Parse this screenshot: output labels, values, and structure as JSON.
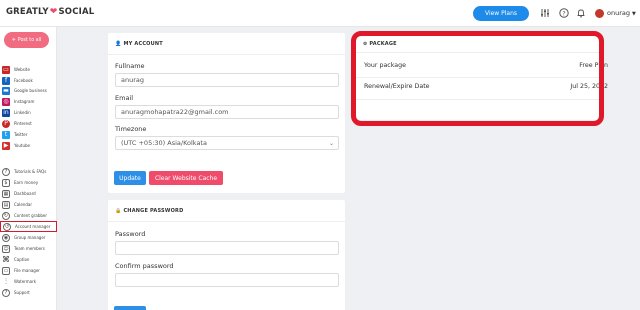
{
  "header": {
    "logo_left": "GREATLY",
    "logo_right": "SOCIAL",
    "view_plans": "View Plans",
    "icons": [
      "sliders-icon",
      "help-icon",
      "bell-icon"
    ],
    "username": "onurag"
  },
  "sidebar": {
    "post_button": "Post to all",
    "items": [
      {
        "label": "Website",
        "icon": "monitor-icon",
        "color": "#c62828"
      },
      {
        "label": "Facebook",
        "icon": "facebook-icon",
        "color": "#1565c0"
      },
      {
        "label": "Google business",
        "icon": "google-business-icon",
        "color": "#1976d2"
      },
      {
        "label": "Instagram",
        "icon": "instagram-icon",
        "color": "#c2185b"
      },
      {
        "label": "Linkedin",
        "icon": "linkedin-icon",
        "color": "#0d47a1"
      },
      {
        "label": "Pinterest",
        "icon": "pinterest-icon",
        "color": "#c62828"
      },
      {
        "label": "Twitter",
        "icon": "twitter-icon",
        "color": "#1da1f2"
      },
      {
        "label": "Youtube",
        "icon": "youtube-icon",
        "color": "#d32f2f"
      },
      {
        "label": "Tutorials & FAQs",
        "icon": "question-icon"
      },
      {
        "label": "Earn money",
        "icon": "money-icon"
      },
      {
        "label": "Dashboard",
        "icon": "dashboard-icon"
      },
      {
        "label": "Calendar",
        "icon": "calendar-icon"
      },
      {
        "label": "Content grabber",
        "icon": "grabber-icon"
      },
      {
        "label": "Account manager",
        "icon": "account-icon"
      },
      {
        "label": "Group manager",
        "icon": "group-icon"
      },
      {
        "label": "Team members",
        "icon": "team-icon"
      },
      {
        "label": "Caption",
        "icon": "caption-icon"
      },
      {
        "label": "File manager",
        "icon": "folder-icon"
      },
      {
        "label": "Watermark",
        "icon": "watermark-icon"
      },
      {
        "label": "Support",
        "icon": "support-icon"
      }
    ]
  },
  "account": {
    "title": "MY ACCOUNT",
    "fullname_label": "Fullname",
    "fullname_value": "anurag",
    "email_label": "Email",
    "email_value": "anuragmohapatra22@gmail.com",
    "timezone_label": "Timezone",
    "timezone_value": "(UTC +05:30) Asia/Kolkata",
    "update_button": "Update",
    "clear_cache_button": "Clear Website Cache"
  },
  "password": {
    "title": "CHANGE PASSWORD",
    "password_label": "Password",
    "confirm_label": "Confirm password"
  },
  "package": {
    "title": "PACKAGE",
    "your_package_label": "Your package",
    "your_package_value": "Free Plan",
    "renewal_label": "Renewal/Expire Date",
    "renewal_value": "Jul 25, 2022"
  },
  "colors": {
    "primary": "#1e8bea",
    "pink": "#ef4b6b",
    "highlight": "#e0192a"
  }
}
